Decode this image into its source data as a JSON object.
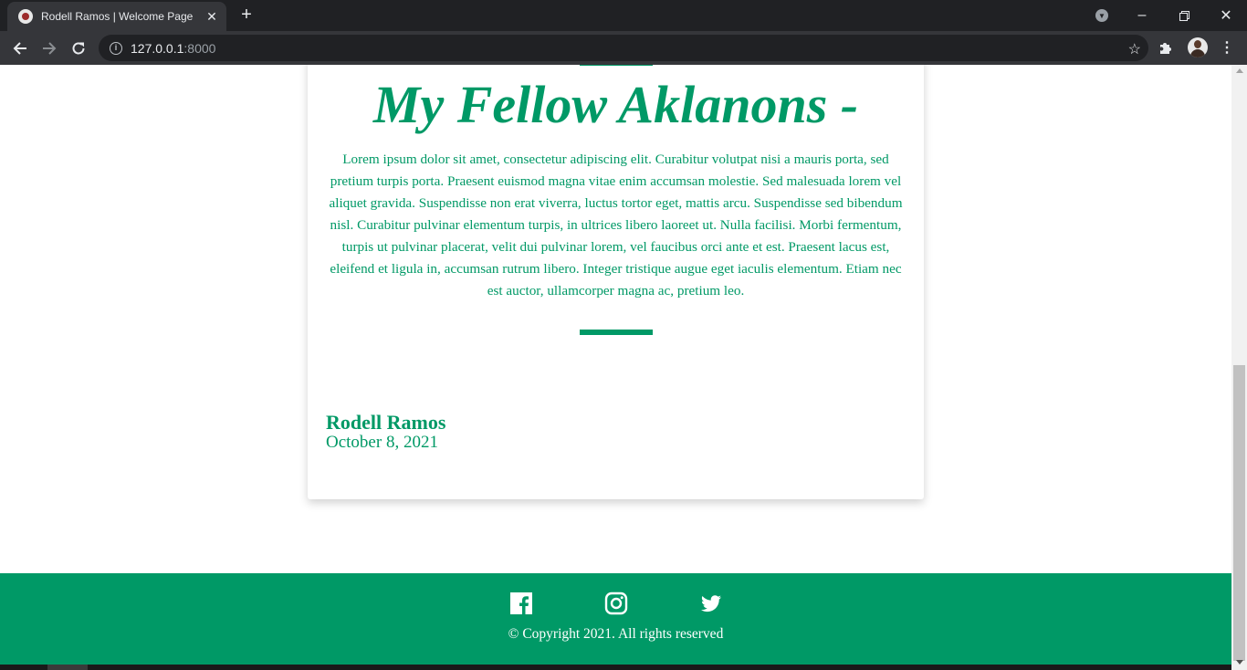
{
  "browser": {
    "tab": {
      "title": "Rodell Ramos | Welcome Page",
      "close_glyph": "✕",
      "favicon_icon": "seal-icon"
    },
    "new_tab_glyph": "+",
    "window": {
      "minimize_glyph": "–",
      "maximize_glyph": "❐",
      "close_glyph": "✕"
    },
    "address": {
      "host": "127.0.0.1",
      "port": ":8000"
    },
    "menu_glyph": "⋮",
    "bookmark_glyph": "☆"
  },
  "page": {
    "heading": "My Fellow Aklanons -",
    "paragraph": "Lorem ipsum dolor sit amet, consectetur adipiscing elit. Curabitur volutpat nisi a mauris porta, sed pretium turpis porta. Praesent euismod magna vitae enim accumsan molestie. Sed malesuada lorem vel aliquet gravida. Suspendisse non erat viverra, luctus tortor eget, mattis arcu. Suspendisse sed bibendum nisl. Curabitur pulvinar elementum turpis, in ultrices libero laoreet ut. Nulla facilisi. Morbi fermentum, turpis ut pulvinar placerat, velit dui pulvinar lorem, vel faucibus orci ante et est. Praesent lacus est, eleifend et ligula in, accumsan rutrum libero. Integer tristique augue eget iaculis elementum. Etiam nec est auctor, ullamcorper magna ac, pretium leo.",
    "author": "Rodell Ramos",
    "date": "October 8, 2021"
  },
  "footer": {
    "social": [
      {
        "name": "facebook",
        "icon": "facebook-icon"
      },
      {
        "name": "instagram",
        "icon": "instagram-icon"
      },
      {
        "name": "twitter",
        "icon": "twitter-icon"
      }
    ],
    "copyright": "© Copyright 2021. All rights reserved"
  },
  "colors": {
    "accent": "#009966",
    "chrome_dark": "#202124",
    "chrome_toolbar": "#35363a"
  }
}
